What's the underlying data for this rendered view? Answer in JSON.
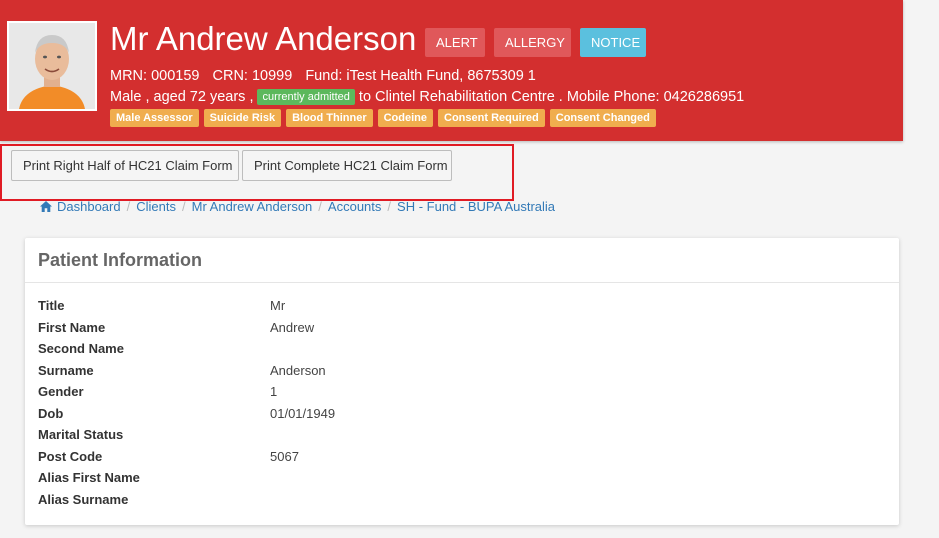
{
  "patient": {
    "name": "Mr Andrew Anderson",
    "mrn": "MRN: 000159",
    "crn": "CRN: 10999",
    "fund": "Fund: iTest Health Fund, 8675309 1",
    "demographics": "Male , aged 72 years ,",
    "admission_badge": "currently admitted",
    "admission_location": "to Clintel Rehabilitation Centre . Mobile Phone: 0426286951"
  },
  "header_buttons": {
    "alert": "ALERT",
    "allergy": "ALLERGY",
    "notice": "NOTICE"
  },
  "tags": [
    "Male Assessor",
    "Suicide Risk",
    "Blood Thinner",
    "Codeine",
    "Consent Required",
    "Consent Changed"
  ],
  "print_buttons": {
    "right_half": "Print Right Half of HC21 Claim Form",
    "complete": "Print Complete HC21 Claim Form"
  },
  "breadcrumb": [
    "Dashboard",
    "Clients",
    "Mr Andrew Anderson",
    "Accounts",
    "SH - Fund - BUPA Australia"
  ],
  "panel": {
    "title": "Patient Information",
    "rows": [
      {
        "label": "Title",
        "value": "Mr"
      },
      {
        "label": "First Name",
        "value": "Andrew"
      },
      {
        "label": "Second Name",
        "value": ""
      },
      {
        "label": "Surname",
        "value": "Anderson"
      },
      {
        "label": "Gender",
        "value": "1"
      },
      {
        "label": "Dob",
        "value": "01/01/1949"
      },
      {
        "label": "Marital Status",
        "value": ""
      },
      {
        "label": "Post Code",
        "value": "5067"
      },
      {
        "label": "Alias First Name",
        "value": ""
      },
      {
        "label": "Alias Surname",
        "value": ""
      }
    ]
  },
  "colors": {
    "header_red": "#d32f2f",
    "alert_btn": "#e0585a",
    "notice_btn": "#5bc0de",
    "admitted_green": "#5cb85c",
    "tag_orange": "#f0ad4e",
    "link_blue": "#337ab7",
    "highlight_red": "#e01b24"
  },
  "icons": {
    "breadcrumb_home": "home-icon",
    "patient_photo": "avatar"
  }
}
